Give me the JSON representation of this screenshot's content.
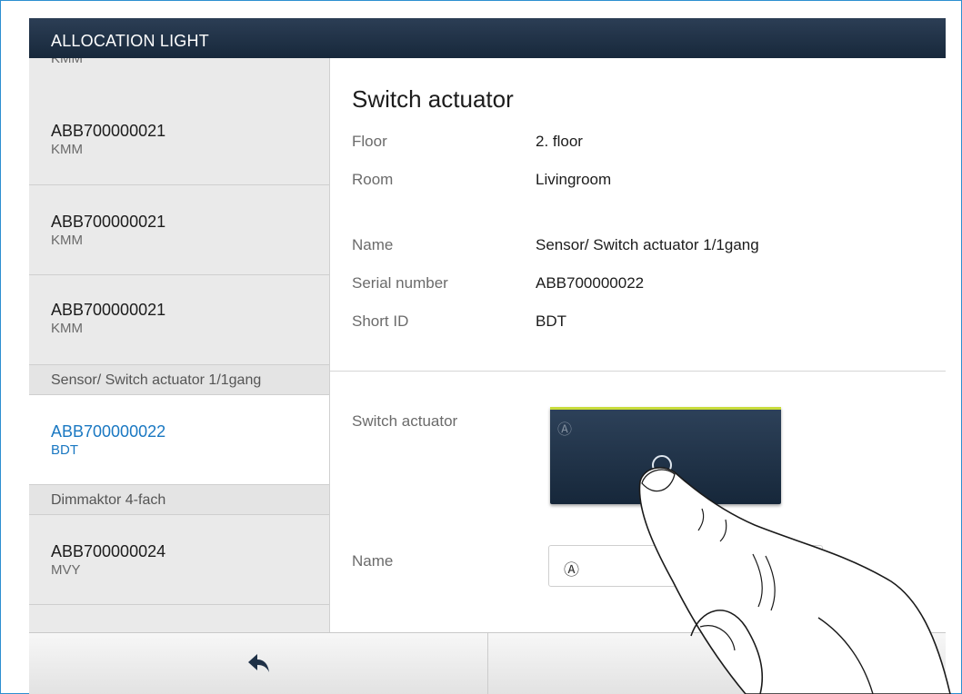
{
  "header": {
    "title": "ALLOCATION LIGHT"
  },
  "sidebar": {
    "partial_item": "KMM",
    "items": [
      {
        "serial": "ABB700000021",
        "short_id": "KMM"
      },
      {
        "serial": "ABB700000021",
        "short_id": "KMM"
      },
      {
        "serial": "ABB700000021",
        "short_id": "KMM"
      },
      {
        "serial": "ABB700000022",
        "short_id": "BDT"
      },
      {
        "serial": "ABB700000024",
        "short_id": "MVY"
      }
    ],
    "groups": [
      {
        "label": "Sensor/ Switch actuator 1/1gang"
      },
      {
        "label": "Dimmaktor 4-fach"
      }
    ]
  },
  "detail": {
    "title": "Switch actuator",
    "fields": [
      {
        "label": "Floor",
        "value": "2. floor"
      },
      {
        "label": "Room",
        "value": "Livingroom"
      },
      {
        "label": "Name",
        "value": "Sensor/ Switch actuator 1/1gang"
      },
      {
        "label": "Serial number",
        "value": "ABB700000022"
      },
      {
        "label": "Short ID",
        "value": "BDT"
      }
    ],
    "actuator_label": "Switch actuator",
    "actuator_tile": {
      "badge": "Ⓐ",
      "icon": "power-icon",
      "accent": "#c8dc3c"
    },
    "name_label": "Name",
    "name_field": {
      "badge": "Ⓐ",
      "value": ""
    }
  },
  "toolbar": {
    "back_icon": "back-arrow-icon"
  },
  "colors": {
    "header": "#1e3046",
    "active": "#1a78c2",
    "frame": "#2d8fd0"
  }
}
